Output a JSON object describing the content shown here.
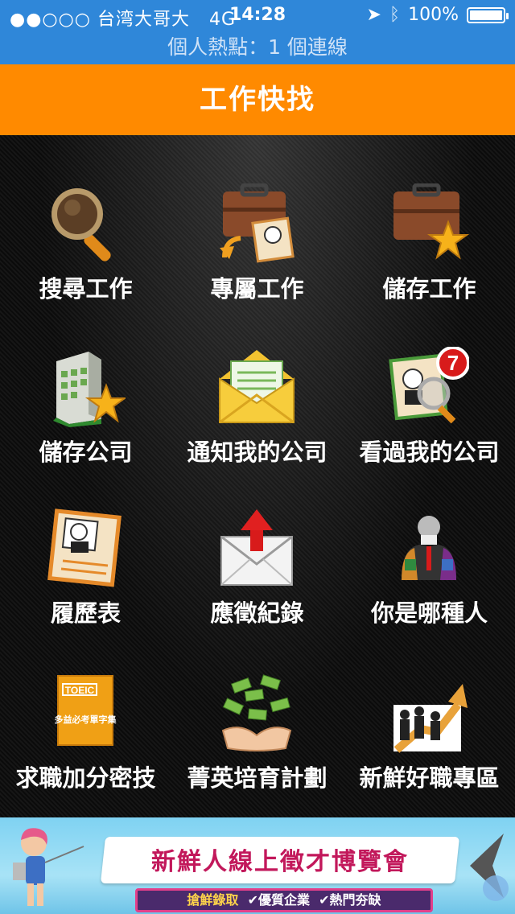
{
  "status": {
    "carrier": "●●○○○ 台湾大哥大",
    "network": "4G",
    "time": "14:28",
    "battery": "100%",
    "hotspot": "個人熱點：1 個連線"
  },
  "header": {
    "title": "工作快找"
  },
  "menu": [
    {
      "label": "搜尋工作",
      "icon": "magnifier-icon"
    },
    {
      "label": "專屬工作",
      "icon": "briefcase-profile-icon"
    },
    {
      "label": "儲存工作",
      "icon": "briefcase-star-icon"
    },
    {
      "label": "儲存公司",
      "icon": "building-star-icon"
    },
    {
      "label": "通知我的公司",
      "icon": "envelope-icon"
    },
    {
      "label": "看過我的公司",
      "icon": "profile-magnifier-icon",
      "badge": "7"
    },
    {
      "label": "履歷表",
      "icon": "resume-icon"
    },
    {
      "label": "應徵紀錄",
      "icon": "envelope-upload-icon"
    },
    {
      "label": "你是哪種人",
      "icon": "person-puzzle-icon"
    },
    {
      "label": "求職加分密技",
      "icon": "toeic-book-icon",
      "book_title": "TOEIC",
      "book_text": "多益必考單字集"
    },
    {
      "label": "菁英培育計劃",
      "icon": "money-hands-icon"
    },
    {
      "label": "新鮮好職專區",
      "icon": "graduates-arrow-icon"
    }
  ],
  "banner": {
    "headline": "新鮮人線上徵才博覽會",
    "sub_1": "搶鮮錄取",
    "sub_2": "✔優質企業",
    "sub_3": "✔熱門夯缺"
  },
  "colors": {
    "status_bar": "#2f87d9",
    "title_bar": "#ff8a00",
    "badge": "#d81b1b"
  }
}
